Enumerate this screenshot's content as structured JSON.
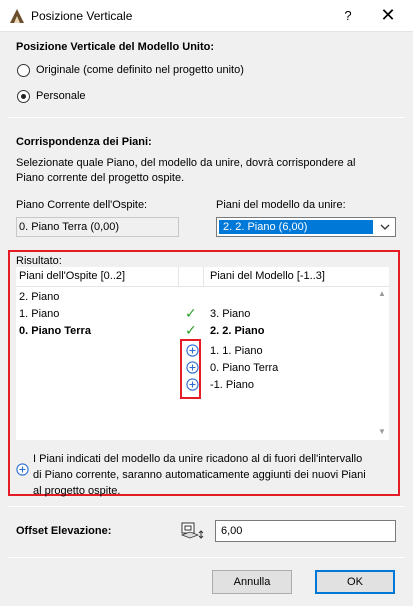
{
  "window": {
    "title": "Posizione Verticale",
    "help_label": "?",
    "close_label": "✕"
  },
  "section_position": {
    "heading": "Posizione Verticale del Modello Unito:",
    "options": [
      {
        "label": "Originale (come definito nel progetto unito)",
        "selected": false
      },
      {
        "label": "Personale",
        "selected": true
      }
    ]
  },
  "section_match": {
    "heading": "Corrispondenza dei Piani:",
    "description_line1": "Selezionate quale Piano, del modello da unire, dovrà corrispondere al",
    "description_line2": "Piano corrente del progetto ospite.",
    "host_label": "Piano Corrente dell'Ospite:",
    "host_value": "0. Piano Terra (0,00)",
    "model_label": "Piani del modello da unire:",
    "model_selected": "2. 2. Piano (6,00)"
  },
  "result": {
    "label": "Risultato:",
    "col_host": "Piani dell'Ospite [0..2]",
    "col_model": "Piani del Modello [-1..3]",
    "rows": [
      {
        "host": "2. Piano",
        "status": "",
        "model": "",
        "bold": false
      },
      {
        "host": "1. Piano",
        "status": "check",
        "model": "3. Piano",
        "bold": false
      },
      {
        "host": "0. Piano Terra",
        "status": "check",
        "model": "2. 2. Piano",
        "bold": true
      },
      {
        "host": "",
        "status": "plus",
        "model": "1. 1. Piano",
        "bold": false
      },
      {
        "host": "",
        "status": "plus",
        "model": "0. Piano Terra",
        "bold": false
      },
      {
        "host": "",
        "status": "plus",
        "model": "-1. Piano",
        "bold": false
      }
    ],
    "info_line1": "I Piani indicati del modello da unire ricadono al di fuori dell'intervallo",
    "info_line2": "di Piano corrente, saranno automaticamente aggiunti dei nuovi Piani",
    "info_line3": "al progetto ospite."
  },
  "offset": {
    "label": "Offset Elevazione:",
    "value": "6,00"
  },
  "buttons": {
    "cancel": "Annulla",
    "ok": "OK"
  },
  "colors": {
    "selection": "#0078d7",
    "highlight_box": "#e51c23",
    "check": "#2e9e2e",
    "plus": "#2f6fd1"
  }
}
